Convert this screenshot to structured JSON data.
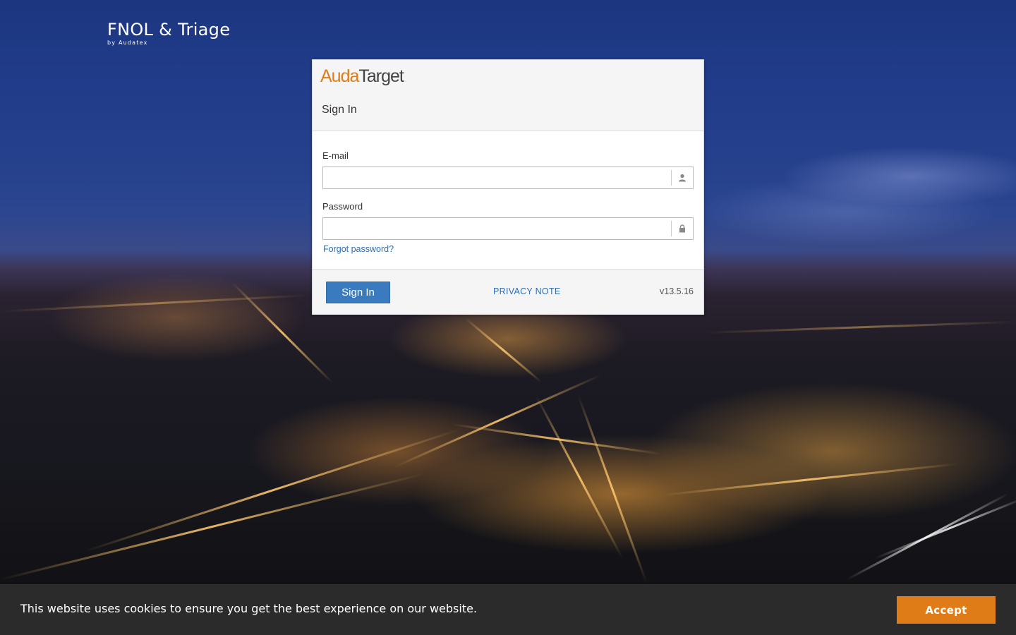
{
  "brand": {
    "name": "FNOL & Triage",
    "sub": "by Audatex"
  },
  "login": {
    "logo_part1": "Auda",
    "logo_part2": "Target",
    "title": "Sign In",
    "email_label": "E-mail",
    "email_value": "",
    "email_icon": "user-icon",
    "password_label": "Password",
    "password_value": "",
    "password_icon": "lock-icon",
    "forgot_label": "Forgot password?",
    "signin_label": "Sign In",
    "privacy_label": "PRIVACY NOTE",
    "version": "v13.5.16"
  },
  "cookie": {
    "message": "This website uses cookies to ensure you get the best experience on our website.",
    "accept_label": "Accept"
  },
  "colors": {
    "accent_orange": "#e07c17",
    "primary_blue": "#3a7bc0",
    "link_blue": "#2a6eb8",
    "cookie_bar": "#2b2b2b"
  }
}
